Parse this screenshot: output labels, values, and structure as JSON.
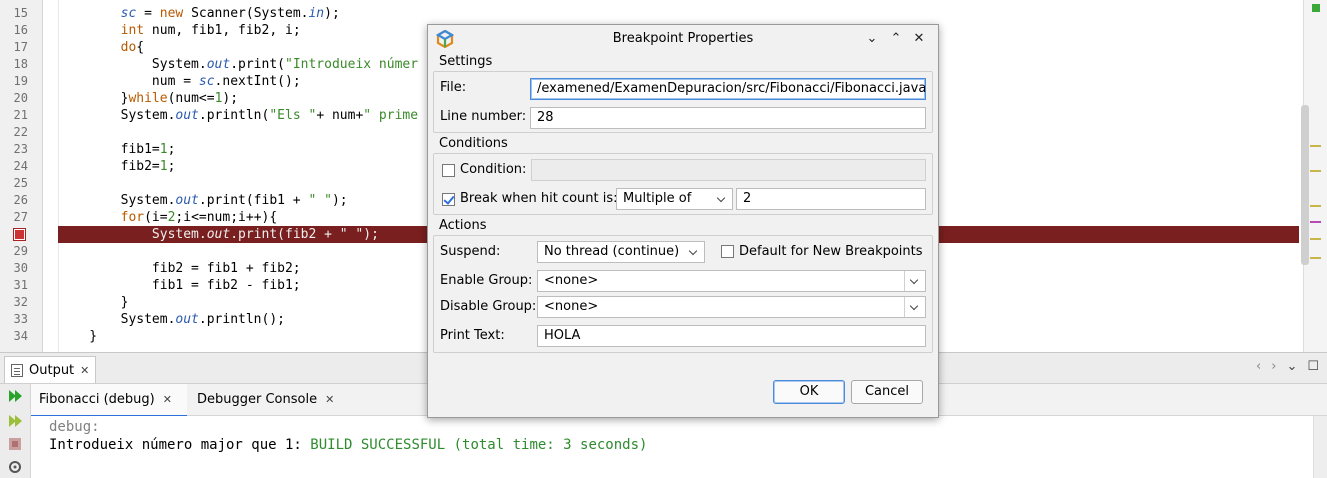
{
  "editor": {
    "line_numbers": [
      "15",
      "16",
      "17",
      "18",
      "19",
      "20",
      "21",
      "22",
      "23",
      "24",
      "25",
      "26",
      "27",
      "",
      "29",
      "30",
      "31",
      "32",
      "33",
      "34"
    ],
    "lines": [
      [
        {
          "t": "        ",
          "c": ""
        },
        {
          "t": "sc",
          "c": "fld"
        },
        {
          "t": " = ",
          "c": ""
        },
        {
          "t": "new",
          "c": "kw"
        },
        {
          "t": " Scanner(System.",
          "c": ""
        },
        {
          "t": "in",
          "c": "fld"
        },
        {
          "t": ");",
          "c": ""
        }
      ],
      [
        {
          "t": "        ",
          "c": ""
        },
        {
          "t": "int",
          "c": "kw"
        },
        {
          "t": " num, fib1, fib2, i;",
          "c": ""
        }
      ],
      [
        {
          "t": "        ",
          "c": ""
        },
        {
          "t": "do",
          "c": "kw"
        },
        {
          "t": "{",
          "c": ""
        }
      ],
      [
        {
          "t": "            System.",
          "c": ""
        },
        {
          "t": "out",
          "c": "fld"
        },
        {
          "t": ".print(",
          "c": ""
        },
        {
          "t": "\"Introdueix númer",
          "c": "str"
        }
      ],
      [
        {
          "t": "            num = ",
          "c": ""
        },
        {
          "t": "sc",
          "c": "fld"
        },
        {
          "t": ".nextInt();",
          "c": ""
        }
      ],
      [
        {
          "t": "        }",
          "c": ""
        },
        {
          "t": "while",
          "c": "kw"
        },
        {
          "t": "(num<=",
          "c": ""
        },
        {
          "t": "1",
          "c": "num"
        },
        {
          "t": ");",
          "c": ""
        }
      ],
      [
        {
          "t": "        System.",
          "c": ""
        },
        {
          "t": "out",
          "c": "fld"
        },
        {
          "t": ".println(",
          "c": ""
        },
        {
          "t": "\"Els \"",
          "c": "str"
        },
        {
          "t": "+ num+",
          "c": ""
        },
        {
          "t": "\" prime",
          "c": "str"
        }
      ],
      [],
      [
        {
          "t": "        fib1=",
          "c": ""
        },
        {
          "t": "1",
          "c": "num"
        },
        {
          "t": ";",
          "c": ""
        }
      ],
      [
        {
          "t": "        fib2=",
          "c": ""
        },
        {
          "t": "1",
          "c": "num"
        },
        {
          "t": ";",
          "c": ""
        }
      ],
      [],
      [
        {
          "t": "        System.",
          "c": ""
        },
        {
          "t": "out",
          "c": "fld"
        },
        {
          "t": ".print(fib1 + ",
          "c": ""
        },
        {
          "t": "\" \"",
          "c": "str"
        },
        {
          "t": ");",
          "c": ""
        }
      ],
      [
        {
          "t": "        ",
          "c": ""
        },
        {
          "t": "for",
          "c": "kw"
        },
        {
          "t": "(i=",
          "c": ""
        },
        {
          "t": "2",
          "c": "num"
        },
        {
          "t": ";i<=num;i++){",
          "c": ""
        }
      ],
      [
        {
          "t": "            System.",
          "c": ""
        },
        {
          "t": "out",
          "c": "fld"
        },
        {
          "t": ".print(fib2 + ",
          "c": ""
        },
        {
          "t": "\" \"",
          "c": "str"
        },
        {
          "t": ");",
          "c": ""
        }
      ],
      [],
      [
        {
          "t": "            fib2 = fib1 + fib2;",
          "c": ""
        }
      ],
      [
        {
          "t": "            fib1 = fib2 - fib1;",
          "c": ""
        }
      ],
      [
        {
          "t": "        }",
          "c": ""
        }
      ],
      [
        {
          "t": "        System.",
          "c": ""
        },
        {
          "t": "out",
          "c": "fld"
        },
        {
          "t": ".println();",
          "c": ""
        }
      ],
      [
        {
          "t": "    }",
          "c": ""
        }
      ]
    ],
    "highlight_line_index": 13,
    "breakpoint_color": "#7a1f1f"
  },
  "dialog": {
    "title": "Breakpoint Properties",
    "window_controls": [
      "chevron-down",
      "chevron-up",
      "close"
    ],
    "settings": {
      "group_label": "Settings",
      "file_label": "File:",
      "file_value": "/examened/ExamenDepuracion/src/Fibonacci/Fibonacci.java",
      "line_label": "Line number:",
      "line_value": "28"
    },
    "conditions": {
      "group_label": "Conditions",
      "condition_label": "Condition:",
      "condition_checked": false,
      "condition_value": "",
      "hitcount_label": "Break when hit count is:",
      "hitcount_checked": true,
      "hitcount_mode": "Multiple of",
      "hitcount_value": "2"
    },
    "actions": {
      "group_label": "Actions",
      "suspend_label": "Suspend:",
      "suspend_value": "No thread (continue)",
      "default_label": "Default for New Breakpoints",
      "default_checked": false,
      "enable_group_label": "Enable Group:",
      "enable_group_value": "<none>",
      "disable_group_label": "Disable Group:",
      "disable_group_value": "<none>",
      "print_text_label": "Print Text:",
      "print_text_value": "HOLA"
    },
    "ok_label": "OK",
    "cancel_label": "Cancel"
  },
  "output": {
    "panel_title": "Output",
    "tabs": [
      {
        "label": "Fibonacci (debug)",
        "active": true
      },
      {
        "label": "Debugger Console",
        "active": false
      }
    ],
    "console_line1": "debug:",
    "console_line2_prefix": "Introdueix número major que 1: ",
    "console_line2_status": "BUILD SUCCESSFUL (total time: 3 seconds)",
    "status_color": "#2e8b2e"
  },
  "icons": [
    "netbeans-logo-icon",
    "breakpoint-icon",
    "output-doc-icon",
    "rerun-icon",
    "rerun-debug-icon",
    "stop-icon",
    "settings-icon"
  ]
}
